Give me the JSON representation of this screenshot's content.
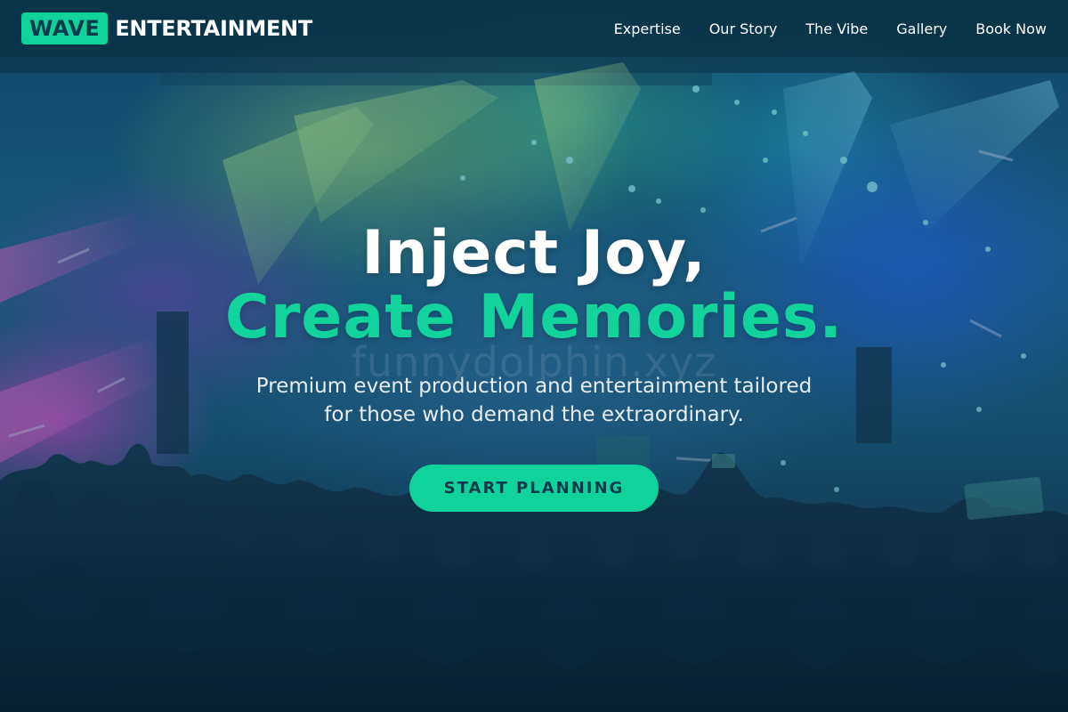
{
  "app": {
    "title": "Wave Entertainment"
  },
  "logo": {
    "badge": "WAVE",
    "text": "ENTERTAINMENT"
  },
  "nav": {
    "items": [
      {
        "label": "Expertise"
      },
      {
        "label": "Our Story"
      },
      {
        "label": "The Vibe"
      },
      {
        "label": "Gallery"
      },
      {
        "label": "Book Now"
      }
    ]
  },
  "hero": {
    "headline_line1": "Inject Joy,",
    "headline_line2": "Create Memories.",
    "subtitle_line1": "Premium event production and entertainment tailored",
    "subtitle_line2": "for those who demand the extraordinary.",
    "cta_label": "START PLANNING",
    "watermark": "funnydolphin.xyz",
    "background_image": "concert-crowd-confetti-photo"
  },
  "colors": {
    "accent": "#10d39b",
    "navbar": "#093448",
    "text_dark": "#0b3a4c",
    "text_light": "#ffffff"
  }
}
